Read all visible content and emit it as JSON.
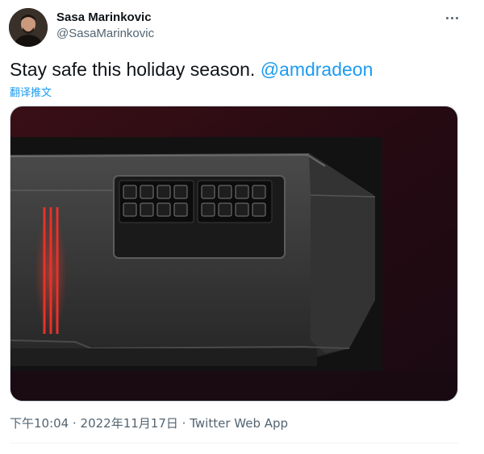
{
  "tweet": {
    "author_name": "Sasa Marinkovic",
    "author_handle": "@SasaMarinkovic",
    "text": "Stay safe this holiday season. ",
    "mention": "@amdradeon",
    "translate_label": "翻译推文",
    "time": "下午10:04",
    "separator1": " · ",
    "date": "2022年11月17日",
    "separator2": " · ",
    "source": "Twitter Web App"
  },
  "icons": {
    "more": "more-horizontal-icon"
  },
  "colors": {
    "link": "#1d9bf0",
    "secondary_text": "#536471",
    "primary_text": "#0f1419",
    "glow_red": "#e8322a"
  }
}
